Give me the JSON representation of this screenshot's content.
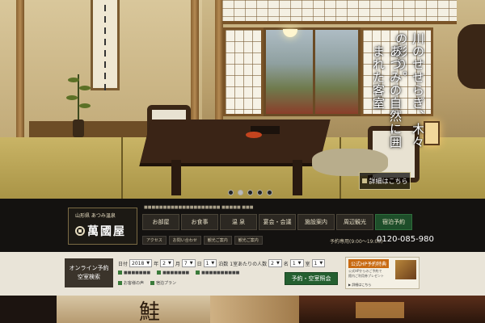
{
  "hero": {
    "copy_lines": [
      "川のせせらぎ、木々の彩り。",
      "あつみの自然に囲まれた客室"
    ],
    "slider_dots": 5,
    "active_dot": 2,
    "detail_button": "詳細はこちら"
  },
  "header": {
    "logo_sub": "山形県 あつみ温泉",
    "logo_name": "萬國屋",
    "tagline": "■■■■■■■■■■■■■■■■■■■■ ■■■■■ ■■■",
    "nav": [
      "お部屋",
      "お食事",
      "温 泉",
      "宴会・会議",
      "施設案内",
      "周辺観光",
      "宿泊予約"
    ],
    "subnav": [
      "アクセス",
      "お問い合わせ",
      "観光ご案内",
      "観光ご案内"
    ],
    "tel_label": "予約専用(9:00～19:00)",
    "tel_number": "0120-085-980"
  },
  "reservation": {
    "title_line1": "オンライン予約",
    "title_line2": "空室検索",
    "date_label": "日付",
    "year": "2018",
    "year_unit": "年",
    "month": "2",
    "month_unit": "月",
    "day": "7",
    "day_unit": "日",
    "nights_label": "泊数",
    "nights": "1",
    "rooms_label": "1室あたりの人数",
    "rooms": "2",
    "adults_label": "名",
    "adults": "1",
    "children_label": "室",
    "children": "1",
    "links": [
      "■■■■■■■",
      "■■■■■■■",
      "■■■■■■■■■■"
    ],
    "links2": [
      "お客様の声",
      "宿泊プラン"
    ],
    "search_button": "予約・空室照会",
    "promo_title": "公式HP予約特典",
    "promo_text_1": "公式HPからのご予約で",
    "promo_text_2": "館内ご利用券プレゼント",
    "promo_link": "詳細はこちら"
  },
  "preview": {
    "heading_char": "鮭"
  }
}
